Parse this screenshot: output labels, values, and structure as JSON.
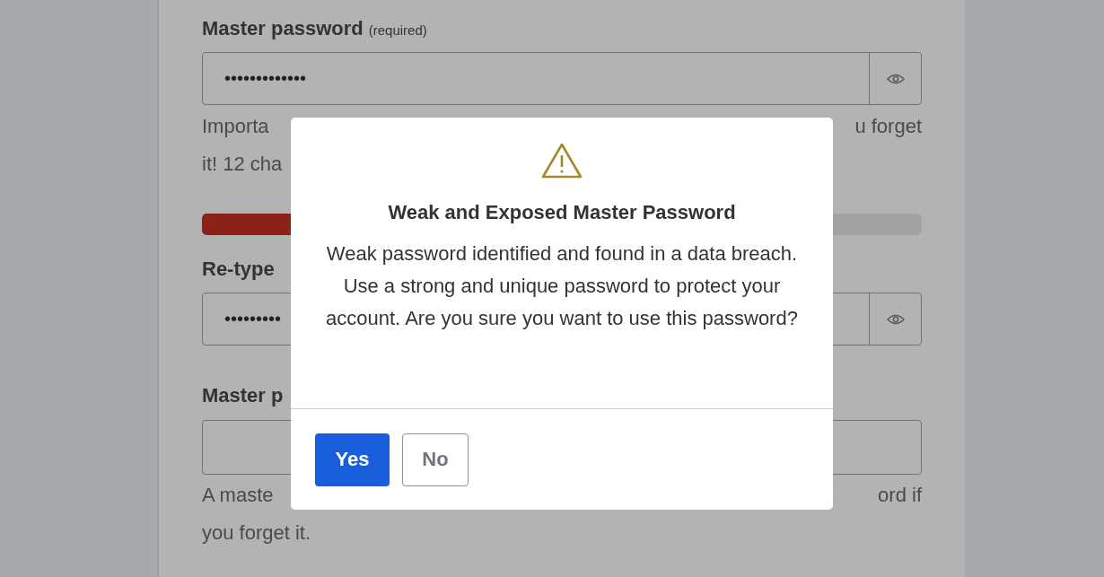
{
  "form": [
    {
      "kind": "label",
      "text": "Master password",
      "note": "(required)"
    },
    {
      "kind": "password_field",
      "value": "•••••••••••••"
    },
    {
      "kind": "split_text",
      "left": "Importa",
      "right": "u forget"
    },
    {
      "kind": "text",
      "text": "it! 12 cha"
    },
    {
      "kind": "strength_bar",
      "level": 0.25
    },
    {
      "kind": "label",
      "text": "Re-type"
    },
    {
      "kind": "password_field",
      "value": "•••••••••"
    },
    {
      "kind": "label",
      "text": "Master p"
    },
    {
      "kind": "text_field"
    },
    {
      "kind": "split_text",
      "left": "A maste",
      "right": "ord if"
    },
    {
      "kind": "text",
      "text": "you forget it."
    }
  ],
  "dialog": {
    "title": "Weak and Exposed Master Password",
    "message": "Weak password identified and found in a data breach. Use a strong and unique password to protect your account. Are you sure you want to use this password?",
    "buttons": [
      {
        "label": "Yes",
        "kind": "primary"
      },
      {
        "label": "No",
        "kind": "secondary"
      }
    ]
  }
}
